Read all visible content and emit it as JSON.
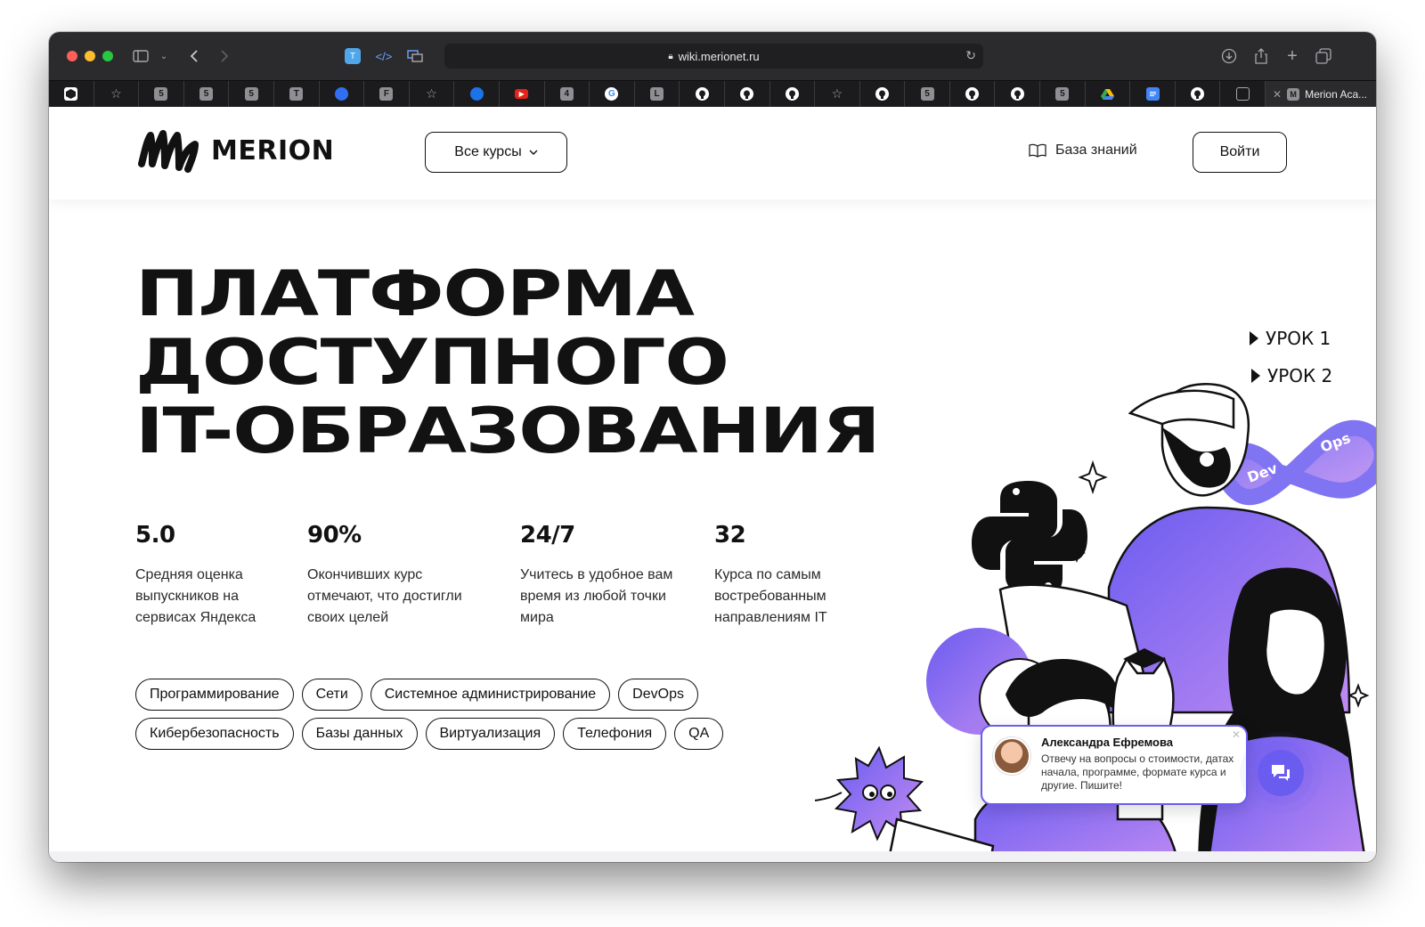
{
  "browser": {
    "url": "wiki.merionet.ru",
    "active_tab_title": "Merion Aca...",
    "tabs": [
      {
        "icon": "merion-icon",
        "letter": "",
        "color": "#3a6fd8"
      },
      {
        "icon": "star-icon",
        "letter": "☆",
        "color": "#1b1b1d"
      },
      {
        "icon": "tab-5-icon",
        "letter": "5",
        "color": "#8e8e93"
      },
      {
        "icon": "tab-5-icon",
        "letter": "5",
        "color": "#8e8e93"
      },
      {
        "icon": "tab-5-icon",
        "letter": "5",
        "color": "#8e8e93"
      },
      {
        "icon": "tab-t-icon",
        "letter": "T",
        "color": "#8e8e93"
      },
      {
        "icon": "blue-drop-icon",
        "letter": "",
        "color": "#2f6ff0"
      },
      {
        "icon": "tab-f-icon",
        "letter": "F",
        "color": "#8e8e93"
      },
      {
        "icon": "star-icon",
        "letter": "☆",
        "color": "#1b1b1d"
      },
      {
        "icon": "blue-gear-icon",
        "letter": "",
        "color": "#1a73e8"
      },
      {
        "icon": "youtube-icon",
        "letter": "▶",
        "color": "#e62117"
      },
      {
        "icon": "tab-4-icon",
        "letter": "4",
        "color": "#8e8e93"
      },
      {
        "icon": "google-icon",
        "letter": "G",
        "color": "#ffffff"
      },
      {
        "icon": "tab-l-icon",
        "letter": "L",
        "color": "#8e8e93"
      },
      {
        "icon": "github-icon",
        "letter": "",
        "color": "#ffffff"
      },
      {
        "icon": "github-icon",
        "letter": "",
        "color": "#ffffff"
      },
      {
        "icon": "github-icon",
        "letter": "",
        "color": "#ffffff"
      },
      {
        "icon": "star-icon",
        "letter": "☆",
        "color": "#1b1b1d"
      },
      {
        "icon": "github-icon",
        "letter": "",
        "color": "#ffffff"
      },
      {
        "icon": "tab-5-icon",
        "letter": "5",
        "color": "#8e8e93"
      },
      {
        "icon": "github-icon",
        "letter": "",
        "color": "#ffffff"
      },
      {
        "icon": "github-icon",
        "letter": "",
        "color": "#ffffff"
      },
      {
        "icon": "tab-5-icon",
        "letter": "5",
        "color": "#8e8e93"
      },
      {
        "icon": "google-drive-icon",
        "letter": "",
        "color": "#1b1b1d"
      },
      {
        "icon": "google-docs-icon",
        "letter": "",
        "color": "#4285f4"
      },
      {
        "icon": "github-icon",
        "letter": "",
        "color": "#ffffff"
      },
      {
        "icon": "screen-icon",
        "letter": "",
        "color": "#1b1b1d"
      }
    ]
  },
  "header": {
    "logo_text": "MERION",
    "courses_button": "Все курсы",
    "knowledge_base": "База знаний",
    "login_button": "Войти"
  },
  "hero": {
    "title_lines": [
      "ПЛАТФОРМА",
      "ДОСТУПНОГО",
      "IT-ОБРАЗОВАНИЯ"
    ],
    "stats": [
      {
        "value": "5.0",
        "description": "Средняя оценка выпускников на сервисах Яндекса"
      },
      {
        "value": "90%",
        "description": "Окончивших курс отмечают, что достигли своих целей"
      },
      {
        "value": "24/7",
        "description": "Учитесь в удобное вам время из любой точки мира"
      },
      {
        "value": "32",
        "description": "Курса по самым востребованным направлениям IT"
      }
    ],
    "tags_row1": [
      "Программирование",
      "Сети",
      "Системное администрирование",
      "DevOps"
    ],
    "tags_row2": [
      "Кибербезопасность",
      "Базы данных",
      "Виртуализация",
      "Телефония",
      "QA"
    ]
  },
  "illustration": {
    "lesson1": "УРОК 1",
    "lesson2": "УРОК 2",
    "dev_label": "Dev",
    "ops_label": "Ops"
  },
  "chat": {
    "name": "Александра Ефремова",
    "message": "Отвечу на вопросы о стоимости, датах начала, программе, формате курса и другие. Пишите!"
  },
  "colors": {
    "accent": "#6b5cf0",
    "text": "#111111",
    "toolbar": "#2b2b2d"
  }
}
